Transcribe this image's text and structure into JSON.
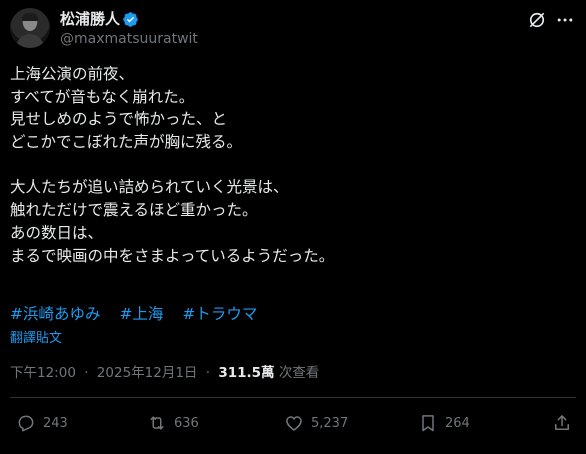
{
  "author": {
    "display_name": "松浦勝人",
    "handle": "@maxmatsuuratwit",
    "verified": true,
    "avatar_icon": "avatar-photo"
  },
  "header_actions": {
    "grok_icon": "grok-icon",
    "more_icon": "more-options-icon"
  },
  "post": {
    "lines": [
      "上海公演の前夜、",
      "すべてが音もなく崩れた。",
      "見せしめのようで怖かった、と",
      "どこかでこぼれた声が胸に残る。",
      "",
      "大人たちが追い詰められていく光景は、",
      "触れただけで震えるほど重かった。",
      "あの数日は、",
      "まるで映画の中をさまよっているようだった。"
    ],
    "hashtags": [
      "#浜崎あゆみ",
      "#上海",
      "#トラウマ"
    ],
    "translate_label": "翻譯貼文"
  },
  "meta": {
    "time": "下午12:00",
    "separator": "·",
    "date": "2025年12月1日",
    "views_count": "311.5萬",
    "views_label": "次查看"
  },
  "actions": {
    "reply": {
      "icon": "reply-icon",
      "count": "243"
    },
    "repost": {
      "icon": "repost-icon",
      "count": "636"
    },
    "like": {
      "icon": "heart-icon",
      "count": "5,237"
    },
    "bookmark": {
      "icon": "bookmark-icon",
      "count": "264"
    },
    "share": {
      "icon": "share-icon"
    }
  },
  "colors": {
    "background": "#000000",
    "text": "#e7e9ea",
    "secondary": "#71767b",
    "accent": "#1d9bf0",
    "divider": "#2f3336"
  }
}
